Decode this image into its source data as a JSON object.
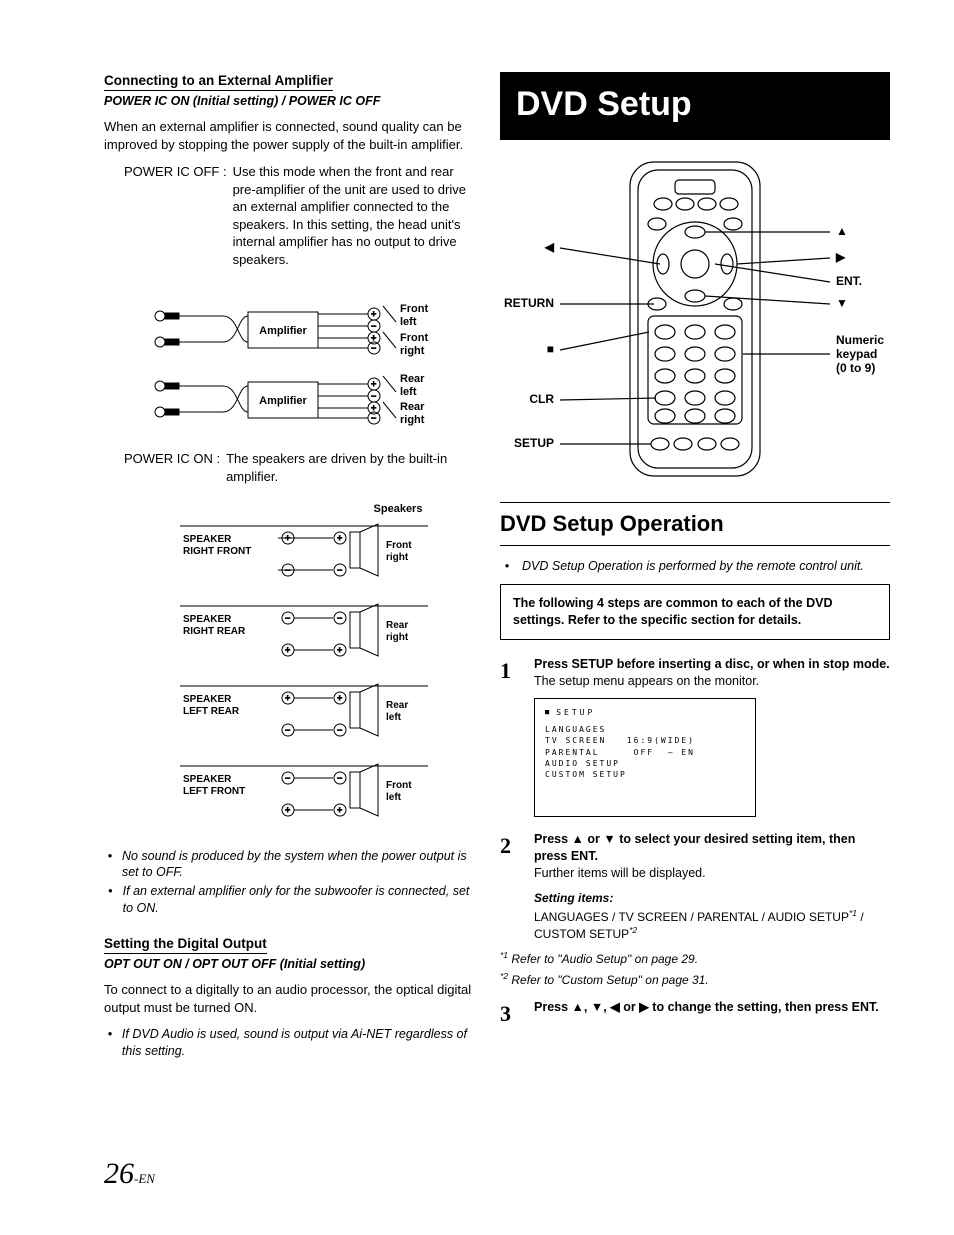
{
  "left": {
    "h1": "Connecting to an External Amplifier",
    "h1sub": "POWER IC ON (Initial setting) / POWER IC OFF",
    "intro": "When an external amplifier is connected, sound quality can be improved by stopping the power supply of the built-in amplifier.",
    "off_term": "POWER IC OFF :",
    "off_desc": "Use this mode when the front and rear pre-amplifier of the unit are used to drive an external amplifier connected to the speakers. In this setting, the head unit's internal amplifier has no output to drive speakers.",
    "amp_label": "Amplifier",
    "fl": "Front left",
    "fr": "Front right",
    "rl": "Rear left",
    "rr": "Rear right",
    "on_term": "POWER IC ON :",
    "on_desc": "The speakers are driven by the built-in amplifier.",
    "speakers_title": "Speakers",
    "srf": "SPEAKER RIGHT FRONT",
    "srr": "SPEAKER RIGHT REAR",
    "slr": "SPEAKER LEFT REAR",
    "slf": "SPEAKER LEFT FRONT",
    "sfr": "Front right",
    "sbr": "Rear right",
    "sbl": "Rear left",
    "sfl": "Front left",
    "note1": "No sound is produced by the system when the power output is set to OFF.",
    "note2": "If an external amplifier only for the subwoofer is connected, set to ON.",
    "h2": "Setting the Digital Output",
    "h2sub": "OPT OUT ON / OPT OUT OFF (Initial setting)",
    "dig_intro": "To connect to a digitally to an audio processor, the optical digital output must be turned ON.",
    "note3": "If DVD Audio is used, sound is output via Ai-NET regardless of this setting."
  },
  "right": {
    "banner": "DVD Setup",
    "remote": {
      "left1": "◀",
      "up": "▲",
      "right1": "▶",
      "down": "▼",
      "ent": "ENT.",
      "return": "RETURN",
      "stop": "■",
      "clr": "CLR",
      "setup": "SETUP",
      "numeric": "Numeric keypad (0 to 9)"
    },
    "sec": "DVD Setup Operation",
    "sec_note": "DVD Setup Operation is performed by the remote control unit.",
    "framed": "The following 4 steps are common to each of the DVD settings. Refer to the specific section for details.",
    "step1a": "Press ",
    "step1b": "SETUP",
    "step1c": " before inserting a disc, or when in stop mode.",
    "step1sub": "The setup menu appears on the monitor.",
    "menu": {
      "title": "SETUP",
      "l1": "LANGUAGES",
      "l2a": "TV SCREEN",
      "l2b": "16:9(WIDE)",
      "l3a": "PARENTAL",
      "l3b": "OFF",
      "l3c": "– EN",
      "l4": "AUDIO SETUP",
      "l5": "CUSTOM SETUP"
    },
    "step2a": "Press ▲ or ▼ to select your desired setting item, then press ",
    "step2b": "ENT.",
    "step2sub": "Further items will be displayed.",
    "setitems_label": "Setting items:",
    "setitems_list": "LANGUAGES / TV SCREEN / PARENTAL / AUDIO SETUP",
    "setitems_tail": " / CUSTOM SETUP",
    "ref1": "Refer to \"Audio Setup\" on page 29.",
    "ref2": "Refer to \"Custom Setup\" on page 31.",
    "step3a": "Press ▲, ▼, ◀ or ▶ to change the setting, then press ",
    "step3b": "ENT."
  },
  "footer": {
    "num": "26",
    "lang": "-EN"
  }
}
